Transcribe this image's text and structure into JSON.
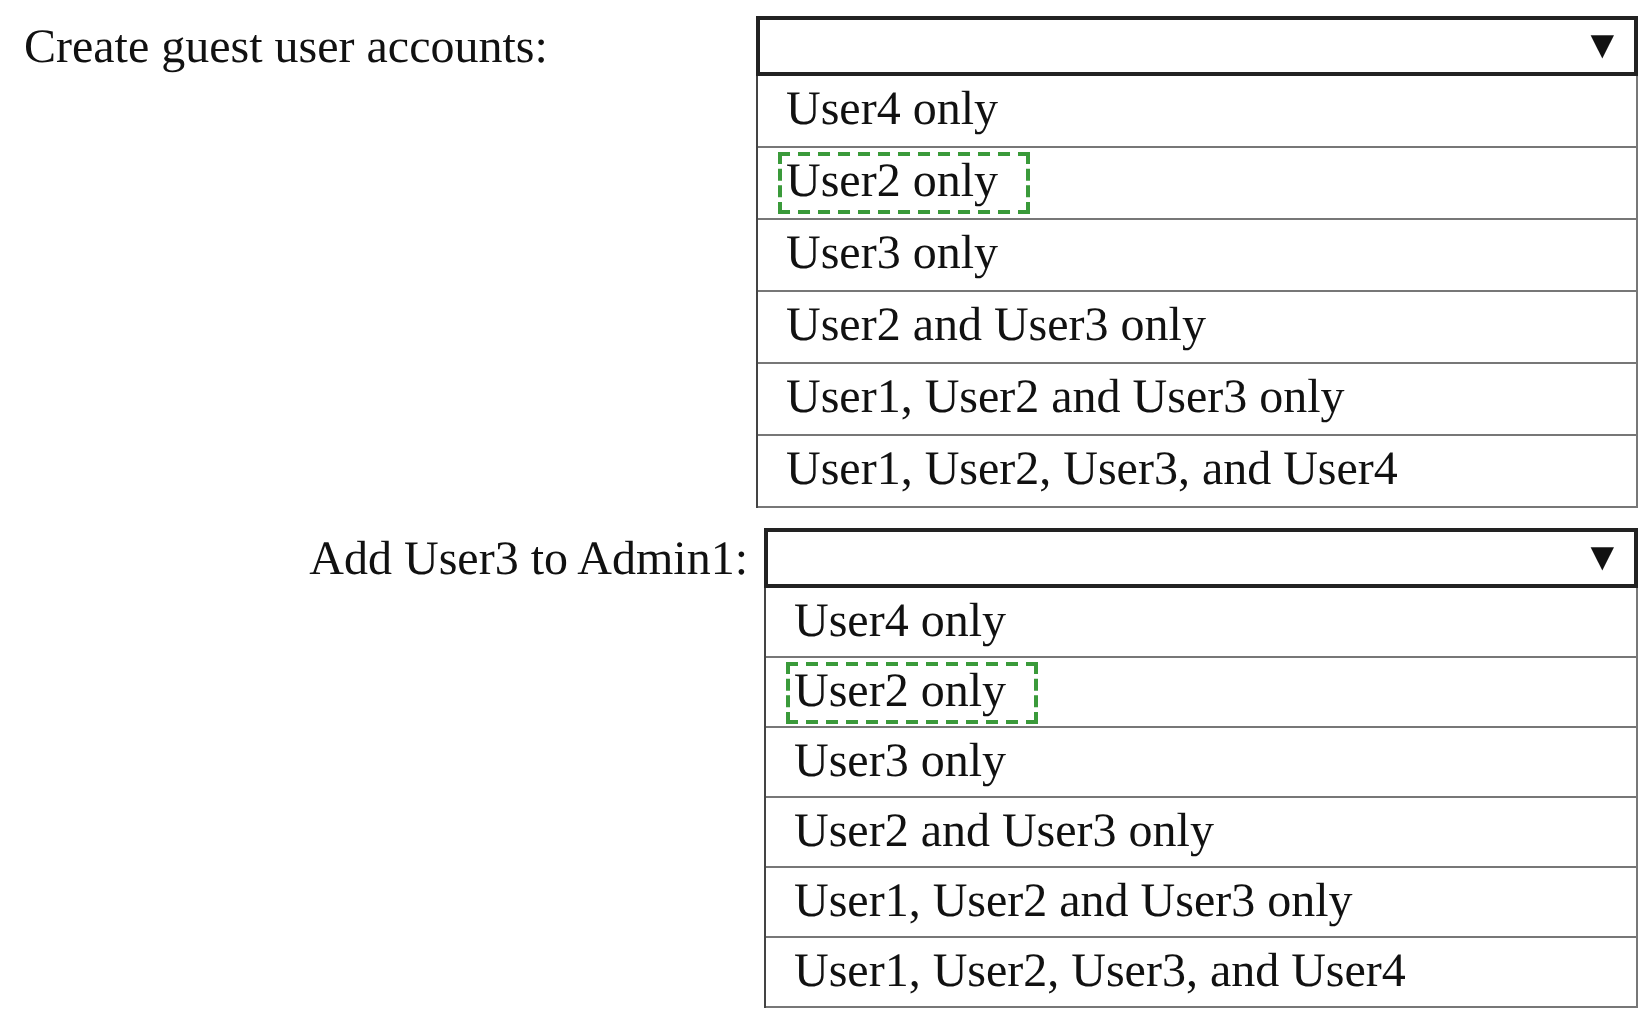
{
  "dropdowns": [
    {
      "label": "Create guest user accounts:",
      "arrow": "▼",
      "options": [
        {
          "text": "User4 only",
          "selected": false
        },
        {
          "text": "User2 only",
          "selected": true
        },
        {
          "text": "User3 only",
          "selected": false
        },
        {
          "text": "User2 and User3 only",
          "selected": false
        },
        {
          "text": "User1, User2 and User3 only",
          "selected": false
        },
        {
          "text": "User1, User2, User3, and User4",
          "selected": false
        }
      ]
    },
    {
      "label": "Add User3 to Admin1:",
      "arrow": "▼",
      "options": [
        {
          "text": "User4 only",
          "selected": false
        },
        {
          "text": "User2 only",
          "selected": true
        },
        {
          "text": "User3 only",
          "selected": false
        },
        {
          "text": "User2 and User3 only",
          "selected": false
        },
        {
          "text": "User1, User2 and User3 only",
          "selected": false
        },
        {
          "text": "User1, User2, User3, and User4",
          "selected": false
        }
      ]
    }
  ]
}
